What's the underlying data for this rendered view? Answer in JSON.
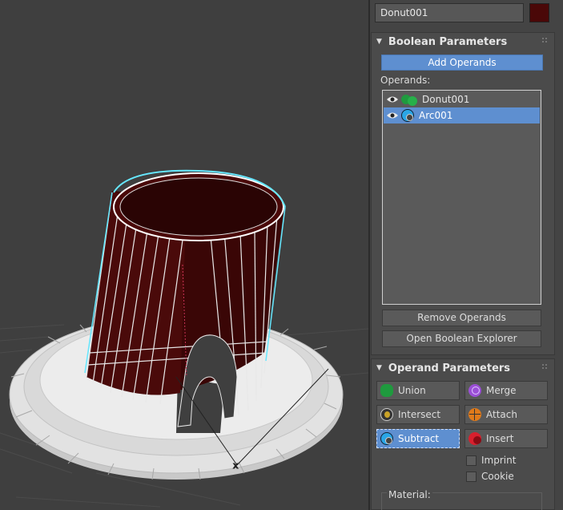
{
  "object": {
    "name": "Donut001",
    "color": "#4a0808"
  },
  "boolean_parameters": {
    "title": "Boolean Parameters",
    "add_operands_label": "Add Operands",
    "operands_label": "Operands:",
    "operands": [
      {
        "name": "Donut001",
        "icon": "union-op-icon",
        "selected": false
      },
      {
        "name": "Arc001",
        "icon": "subtract-op-icon",
        "selected": true
      }
    ],
    "remove_operands_label": "Remove Operands",
    "open_explorer_label": "Open Boolean Explorer"
  },
  "operand_parameters": {
    "title": "Operand Parameters",
    "ops": {
      "union": "Union",
      "merge": "Merge",
      "intersect": "Intersect",
      "attach": "Attach",
      "subtract": "Subtract",
      "insert": "Insert"
    },
    "active_op": "subtract",
    "imprint_label": "Imprint",
    "cookie_label": "Cookie",
    "material_label": "Material:"
  },
  "colors": {
    "accent": "#5e8fd0",
    "union": "#1f9a3e",
    "merge": "#9b4fd6",
    "intersect": "#c9a227",
    "attach": "#e07a1a",
    "subtract": "#2aa6e6",
    "insert": "#d8202e",
    "selection_outline": "#66e8ff"
  }
}
